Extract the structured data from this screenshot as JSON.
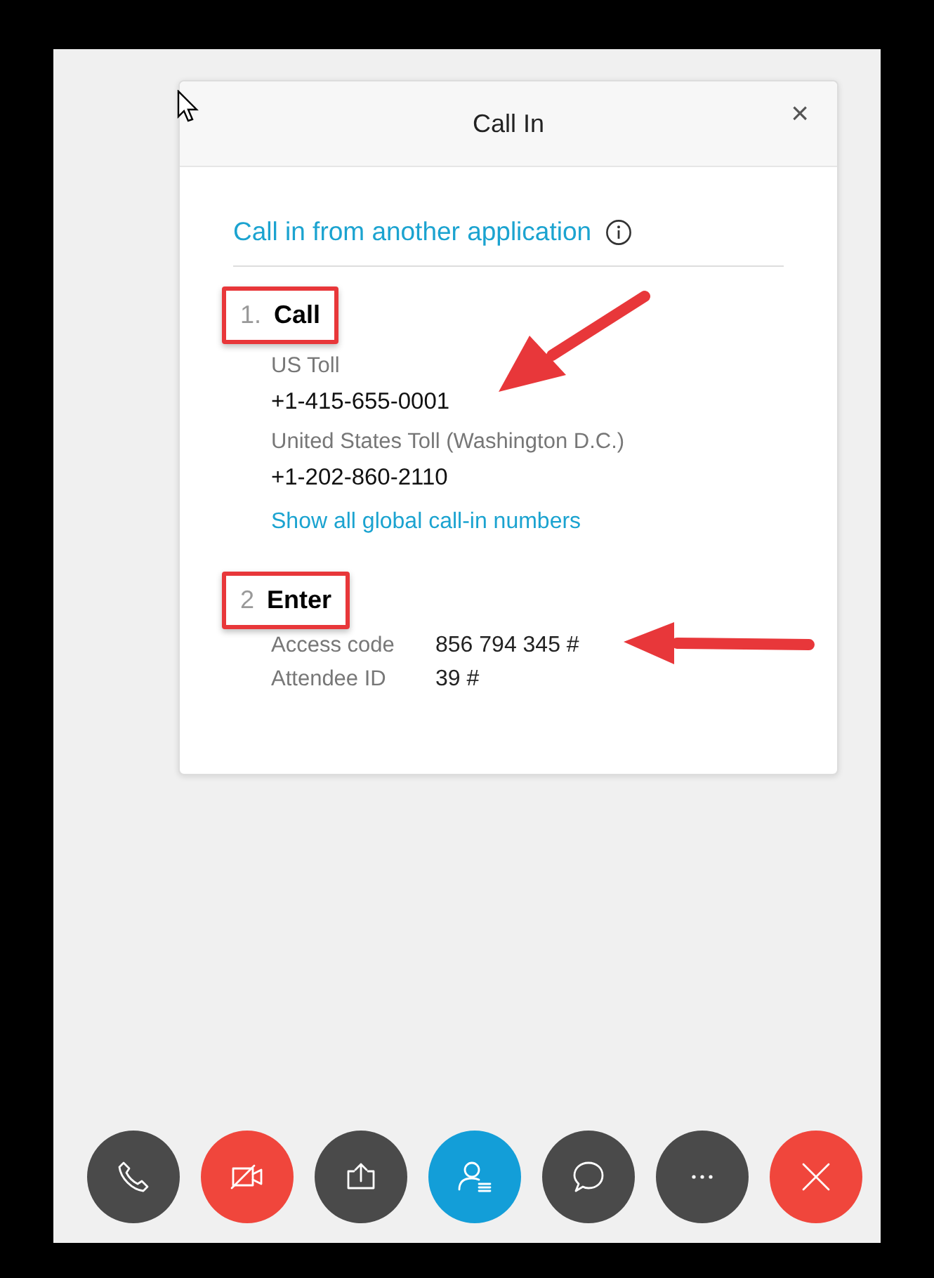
{
  "dialog": {
    "title": "Call In",
    "close": "×"
  },
  "link": "Call in from another application",
  "steps": [
    {
      "kind": "numbers",
      "number": "1.",
      "title": "Call",
      "highlighted": true,
      "entries": [
        {
          "label": "US Toll",
          "number": "+1-415-655-0001",
          "arrow": true
        },
        {
          "label": "United States Toll (Washington D.C.)",
          "number": "+1-202-860-2110",
          "arrow": false
        }
      ],
      "link": "Show all global call-in numbers"
    },
    {
      "kind": "codes",
      "number": "2",
      "title": "Enter",
      "highlighted": true,
      "rows": [
        {
          "label": "Access code",
          "value": "856 794 345 #",
          "arrow": true
        },
        {
          "label": "Attendee ID",
          "value": "39 #",
          "arrow": false
        }
      ]
    }
  ],
  "controls": [
    {
      "kind": "phone",
      "color": "#4a4a4a"
    },
    {
      "kind": "video-off",
      "color": "#f0463c"
    },
    {
      "kind": "share",
      "color": "#4a4a4a"
    },
    {
      "kind": "participants",
      "color": "#139ed8"
    },
    {
      "kind": "chat",
      "color": "#4a4a4a"
    },
    {
      "kind": "more",
      "color": "#4a4a4a"
    },
    {
      "kind": "leave",
      "color": "#f0463c"
    }
  ]
}
